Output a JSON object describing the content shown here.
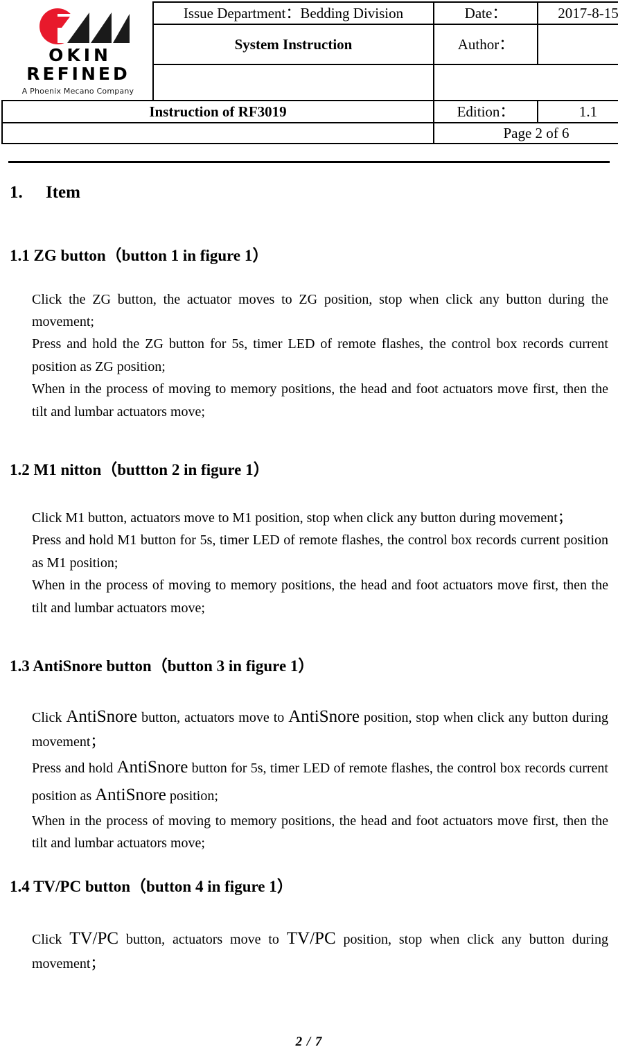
{
  "header": {
    "logo": {
      "mark_name": "okin-logo-mark",
      "brand_line1": "OKIN",
      "brand_line2": "REFINED",
      "tagline": "A Phoenix Mecano Company",
      "accent_color": "#E8192C",
      "mark_color": "#1A1A1A"
    },
    "row1": {
      "issue_department": "Issue Department：Bedding Division",
      "date_label": "Date：",
      "date_value": "2017-8-15"
    },
    "row2": {
      "doc_type": "System Instruction",
      "author_label": "Author：",
      "author_value": ""
    },
    "row3": {
      "blank_left": "",
      "blank_right": ""
    },
    "row4": {
      "doc_title": "Instruction of RF3019",
      "edition_label": "Edition：",
      "edition_value": "1.1"
    },
    "row5": {
      "page_of": "Page 2 of 6"
    }
  },
  "body": {
    "section1": {
      "number": "1.",
      "title": "Item"
    },
    "s11": {
      "heading": "1.1 ZG  button（button 1 in figure 1）",
      "p1": "Click the ZG button, the actuator moves to ZG position, stop when click any button during the movement;",
      "p2": "Press and hold the ZG button for 5s, timer LED of remote flashes, the control box records current position as ZG position;",
      "p3": "When in the process of moving to memory positions, the head and foot actuators move first, then the tilt and lumbar actuators move;"
    },
    "s12": {
      "heading": "1.2  M1 nitton（buttton 2 in figure 1）",
      "p1": "Click M1 button, actuators move to M1 position, stop when click any button during movement；",
      "p2": "Press and hold M1 button for 5s, timer LED of remote flashes, the control box records current position as M1 position;",
      "p3": "When in the process of moving to memory positions, the head and foot actuators move first, then the tilt and lumbar actuators move;"
    },
    "s13": {
      "heading": "1.3  AntiSnore button（button 3 in figure 1）",
      "p1_a": "Click ",
      "p1_b": "AntiSnore",
      "p1_c": " button, actuators move to ",
      "p1_d": "AntiSnore",
      "p1_e": " position, stop when click any button during movement；",
      "p2_a": "Press and hold ",
      "p2_b": "AntiSnore",
      "p2_c": " button for 5s, timer LED of remote flashes, the control box records current position as ",
      "p2_d": "AntiSnore",
      "p2_e": " position;",
      "p3": "When in the process of moving to memory positions, the head and foot actuators move first, then the tilt and lumbar actuators move;"
    },
    "s14": {
      "heading": "1.4 TV/PC button（button 4 in figure 1）",
      "p1_a": "Click ",
      "p1_b": "TV/PC",
      "p1_c": " button, actuators move to ",
      "p1_d": "TV/PC",
      "p1_e": " position, stop when click any button during movement；"
    }
  },
  "footer": {
    "page_number": "2 / 7"
  }
}
